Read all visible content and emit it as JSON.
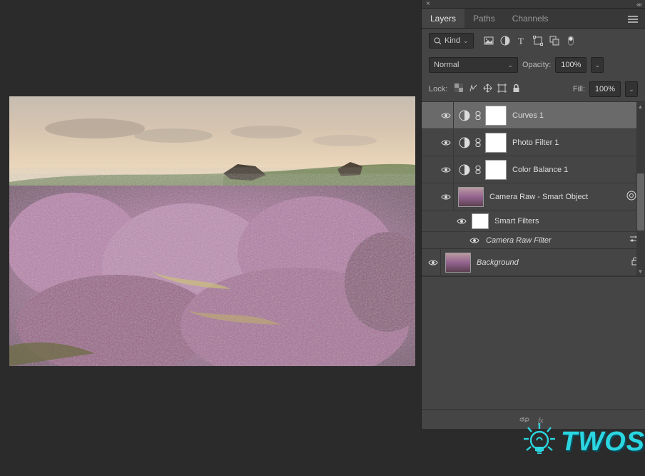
{
  "tabs": {
    "layers": "Layers",
    "paths": "Paths",
    "channels": "Channels"
  },
  "filter": {
    "kind_label": "Kind"
  },
  "blend": {
    "mode": "Normal",
    "opacity_label": "Opacity:",
    "opacity_value": "100%"
  },
  "lock": {
    "label": "Lock:",
    "fill_label": "Fill:",
    "fill_value": "100%"
  },
  "layers": [
    {
      "name": "Curves 1"
    },
    {
      "name": "Photo Filter 1"
    },
    {
      "name": "Color Balance 1"
    },
    {
      "name": "Camera Raw - Smart Object"
    },
    {
      "name": "Smart Filters"
    },
    {
      "name": "Camera Raw Filter"
    },
    {
      "name": "Background"
    }
  ],
  "watermark": {
    "text": "TWOS"
  }
}
